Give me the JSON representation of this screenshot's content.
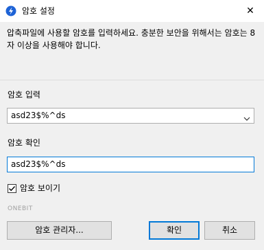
{
  "window": {
    "title": "암호 설정",
    "close_glyph": "✕",
    "icon": "app-logo-icon",
    "accent_color": "#0078d7"
  },
  "description": "압축파일에 사용할 암호를 입력하세요. 충분한 보안을 위해서는 암호는 8자 이상을 사용해야 합니다.",
  "password_input": {
    "label": "암호 입력",
    "value": "asd23$%^ds"
  },
  "password_confirm": {
    "label": "암호 확인",
    "value": "asd23$%^ds"
  },
  "show_password": {
    "label": "암호 보이기",
    "checked": true
  },
  "brand": "ONEBIT",
  "buttons": {
    "manager": "암호 관리자...",
    "ok": "확인",
    "cancel": "취소"
  }
}
